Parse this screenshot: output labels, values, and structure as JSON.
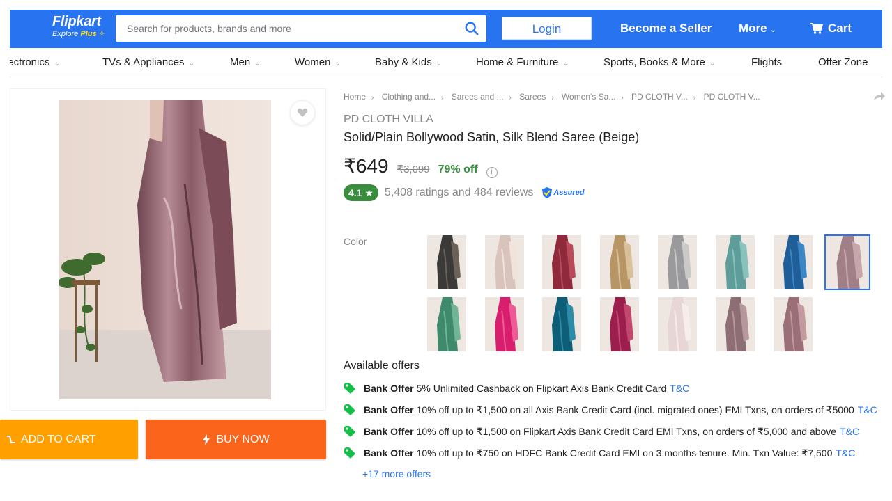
{
  "header": {
    "brand": "Flipkart",
    "explore": "Explore",
    "plus": "Plus",
    "search_placeholder": "Search for products, brands and more",
    "login": "Login",
    "become_seller": "Become a Seller",
    "more": "More",
    "cart": "Cart",
    "colors": {
      "bar": "#2874f0",
      "plus": "#ffe11b"
    }
  },
  "categories": [
    "Electronics",
    "TVs & Appliances",
    "Men",
    "Women",
    "Baby & Kids",
    "Home & Furniture",
    "Sports, Books & More",
    "Flights",
    "Offer Zone"
  ],
  "actions": {
    "add_to_cart": "ADD TO CART",
    "buy_now": "BUY NOW"
  },
  "product": {
    "breadcrumbs": [
      "Home",
      "Clothing and...",
      "Sarees and ...",
      "Sarees",
      "Women's Sa...",
      "PD CLOTH V...",
      "PD CLOTH V..."
    ],
    "seller": "PD CLOTH VILLA",
    "title": "Solid/Plain Bollywood Satin, Silk Blend Saree  (Beige)",
    "price": "₹649",
    "mrp": "₹3,099",
    "discount": "79% off",
    "rating": "4.1",
    "ratings_text": "5,408 ratings and 484 reviews",
    "assured": "Assured",
    "color_label": "Color"
  },
  "swatches": [
    {
      "color": "#3b3a38",
      "accent": "#6b6258"
    },
    {
      "color": "#d9c3bd",
      "accent": "#efe3dc"
    },
    {
      "color": "#8e2a3c",
      "accent": "#b84a5a"
    },
    {
      "color": "#b89564",
      "accent": "#d9c09a"
    },
    {
      "color": "#9a9a9c",
      "accent": "#c9c9ca"
    },
    {
      "color": "#5e9d99",
      "accent": "#88c2bd"
    },
    {
      "color": "#1f5e96",
      "accent": "#3b86c4"
    },
    {
      "color": "#a07f86",
      "accent": "#c7a6ab",
      "selected": true
    },
    {
      "color": "#3f8a6c",
      "accent": "#6fb596"
    },
    {
      "color": "#d81e6c",
      "accent": "#ec5b95"
    },
    {
      "color": "#0f5e78",
      "accent": "#2c8ba6"
    },
    {
      "color": "#9c1e4c",
      "accent": "#c2486f"
    },
    {
      "color": "#e8d6d6",
      "accent": "#f7eded"
    },
    {
      "color": "#8d6e74",
      "accent": "#b5979c"
    },
    {
      "color": "#9a6f77",
      "accent": "#c39aa0"
    }
  ],
  "offers": {
    "title": "Available offers",
    "items": [
      {
        "label": "Bank Offer",
        "text": "5% Unlimited Cashback on Flipkart Axis Bank Credit Card",
        "tc": "T&C"
      },
      {
        "label": "Bank Offer",
        "text": "10% off up to ₹1,500 on all Axis Bank Credit Card (incl. migrated ones) EMI Txns, on orders of ₹5000",
        "tc": "T&C"
      },
      {
        "label": "Bank Offer",
        "text": "10% off up to ₹1,500 on Flipkart Axis Bank Credit Card EMI Txns, on orders of ₹5,000 and above",
        "tc": "T&C"
      },
      {
        "label": "Bank Offer",
        "text": "10% off up to ₹750 on HDFC Bank Credit Card EMI on 3 months tenure. Min. Txn Value: ₹7,500",
        "tc": "T&C"
      }
    ],
    "more": "+17 more offers"
  }
}
